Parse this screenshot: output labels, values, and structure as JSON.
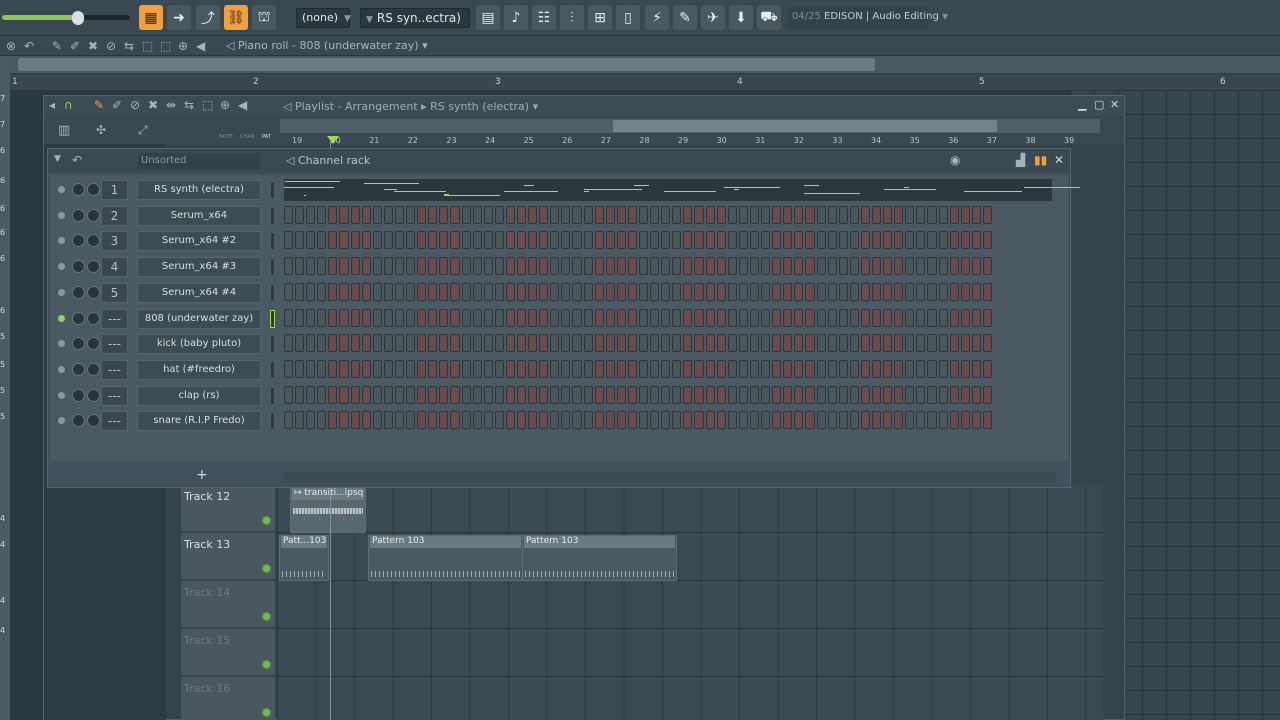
{
  "toolbar": {
    "pattern_selector": "(none)",
    "channel_selector": "RS syn..ectra)",
    "hint_count": "04/25",
    "hint_text": "EDISON | Audio Editing"
  },
  "piano_roll": {
    "title": "Piano roll - 808 (underwater zay)",
    "bar_numbers": [
      "1",
      "2",
      "3",
      "4",
      "5",
      "6"
    ],
    "left_numbers": [
      "7",
      "6",
      "7",
      "6",
      "6",
      "6",
      "6",
      "6",
      "5",
      "5",
      "5",
      "5",
      "4",
      "4",
      "4",
      "4"
    ]
  },
  "playlist": {
    "title": "Playlist - Arrangement",
    "channel": "RS synth (electra)",
    "tool_labels": [
      "NOTE",
      "CHAN",
      "PAT"
    ],
    "ruler": [
      "19",
      "20",
      "21",
      "22",
      "23",
      "24",
      "25",
      "26",
      "27",
      "28",
      "29",
      "30",
      "31",
      "32",
      "33",
      "34",
      "35",
      "36",
      "37",
      "38",
      "39"
    ],
    "tracks": [
      {
        "name": "Track 12"
      },
      {
        "name": "Track 13"
      },
      {
        "name": "Track 14"
      },
      {
        "name": "Track 15"
      },
      {
        "name": "Track 16"
      }
    ],
    "clips": {
      "audio": "transiti...ipsquad",
      "patt_short": "Patt...103",
      "pattern_a": "Pattern 103",
      "pattern_b": "Pattern 103"
    }
  },
  "channel_rack": {
    "title": "Channel rack",
    "sort_label": "Unsorted",
    "channels": [
      {
        "num": "1",
        "name": "RS synth (electra)"
      },
      {
        "num": "2",
        "name": "Serum_x64"
      },
      {
        "num": "3",
        "name": "Serum_x64 #2"
      },
      {
        "num": "4",
        "name": "Serum_x64 #3"
      },
      {
        "num": "5",
        "name": "Serum_x64 #4"
      },
      {
        "num": "---",
        "name": "808 (underwater zay)"
      },
      {
        "num": "---",
        "name": "kick (baby pluto)"
      },
      {
        "num": "---",
        "name": "hat (#freedro)"
      },
      {
        "num": "---",
        "name": "clap (rs)"
      },
      {
        "num": "---",
        "name": "snare (R.I.P Fredo)"
      }
    ],
    "add_label": "+"
  },
  "colors": {
    "accent_orange": "#f2a03b",
    "led_green": "#8ed35a",
    "note_green": "#9fdc4e"
  }
}
